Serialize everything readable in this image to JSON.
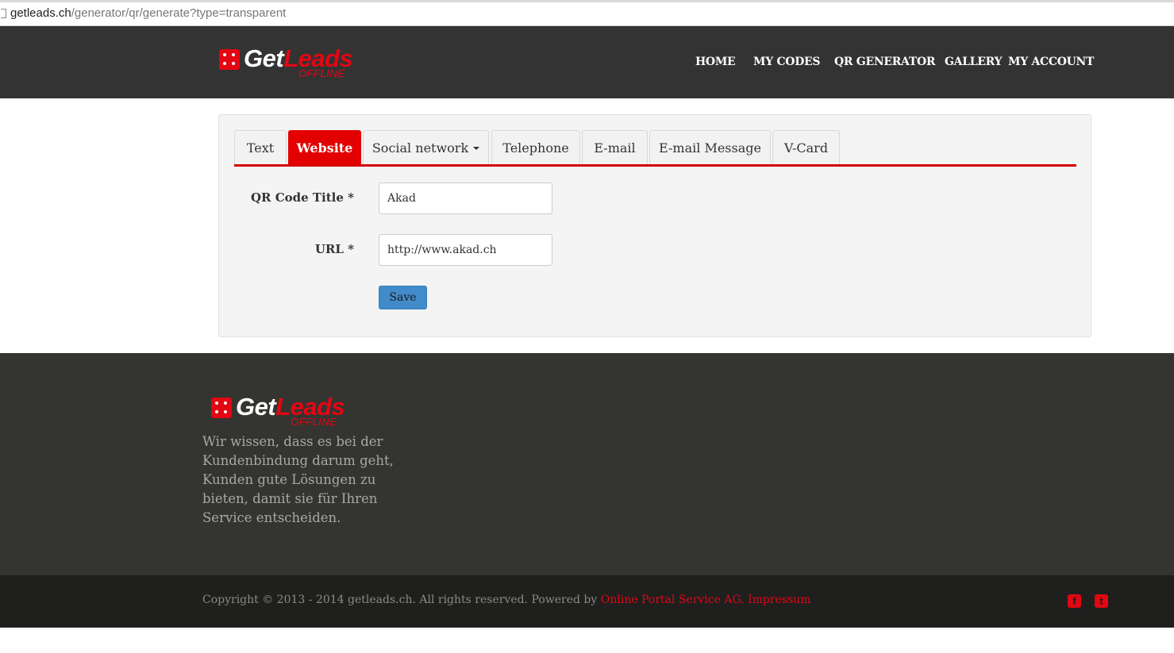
{
  "browser": {
    "url_host": "getleads.ch",
    "url_path": "/generator/qr/generate?type=transparent"
  },
  "brand": {
    "get": "Get",
    "leads": "Leads",
    "offline": "OFFLINE"
  },
  "nav": {
    "items": [
      "HOME",
      "MY CODES",
      "QR GENERATOR",
      "GALLERY",
      "MY ACCOUNT"
    ]
  },
  "tabs": {
    "items": [
      "Text",
      "Website",
      "Social network",
      "Telephone",
      "E-mail",
      "E-mail Message",
      "V-Card"
    ],
    "active": "Website"
  },
  "form": {
    "title_label": "QR Code Title *",
    "title_value": "Akad",
    "url_label": "URL *",
    "url_value": "http://www.akad.ch",
    "save_label": "Save"
  },
  "footer": {
    "text": "Wir wissen, dass es bei der Kundenbindung darum geht, Kunden gute Lösungen zu bieten, damit sie für Ihren Service entscheiden.",
    "copyright": "Copyright © 2013 - 2014 getleads.ch. All rights reserved. Powered by ",
    "powered_link": "Online Portal Service AG.",
    "impressum": "Impressum",
    "facebook_icon": "facebook-icon",
    "twitter_icon": "twitter-icon"
  },
  "colors": {
    "brand_red": "#e30613",
    "nav_bg": "#333333",
    "footer_bg": "#343431",
    "bottom_bar_bg": "#1f1f1e",
    "save_button": "#428bca"
  }
}
